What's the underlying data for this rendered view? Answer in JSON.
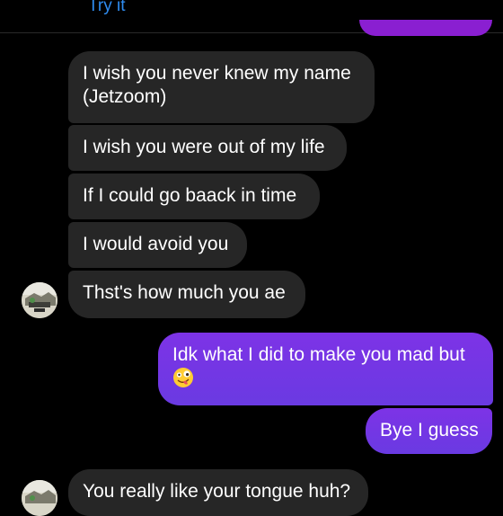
{
  "banner": {
    "try_label": "Try it"
  },
  "messages": [
    {
      "direction": "incoming",
      "text": "I wish you never knew my name (Jetzoom)"
    },
    {
      "direction": "incoming",
      "text": "I wish you were out of my life"
    },
    {
      "direction": "incoming",
      "text": "If I could go baack in time"
    },
    {
      "direction": "incoming",
      "text": "I would avoid you"
    },
    {
      "direction": "incoming",
      "text": "Thst's how much you ae"
    },
    {
      "direction": "outgoing",
      "text": "Idk what I did to make you mad but",
      "emoji": "zany-face-emoji"
    },
    {
      "direction": "outgoing",
      "text": "Bye I guess"
    },
    {
      "direction": "incoming",
      "text": "You really like your tongue huh?"
    }
  ],
  "colors": {
    "background": "#000000",
    "incoming_bubble": "#262626",
    "outgoing_bubble": "#7238e3",
    "link": "#2f8cf0"
  }
}
